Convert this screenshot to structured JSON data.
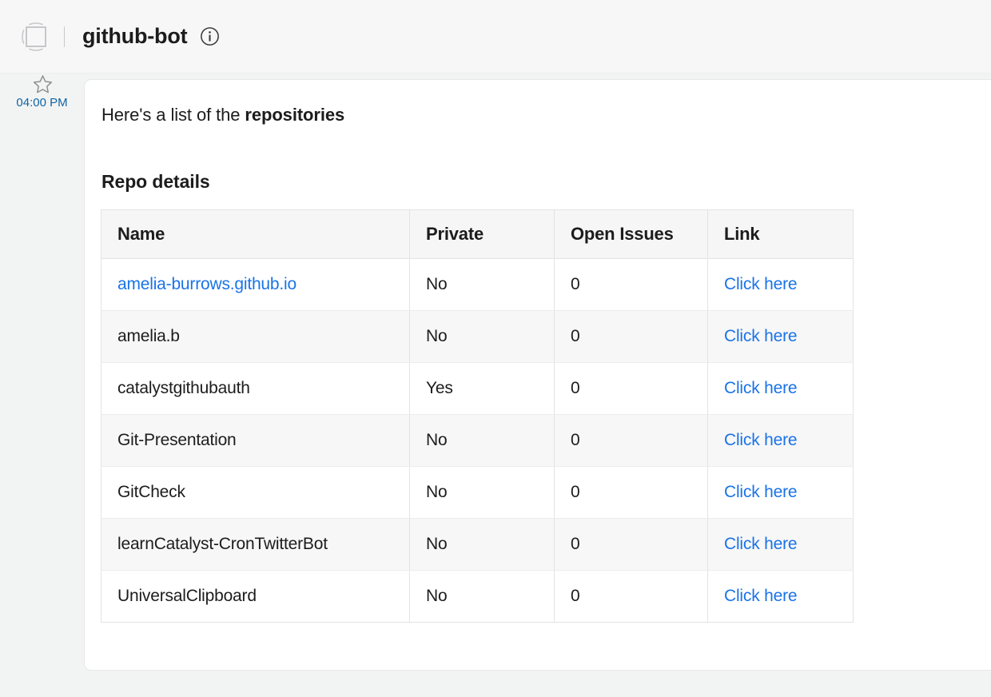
{
  "header": {
    "bot_name": "github-bot",
    "avatar_icon": "app-placeholder-icon",
    "info_icon": "info-circle-icon"
  },
  "gutter": {
    "star_icon": "star-outline-icon",
    "timestamp": "04:00 PM"
  },
  "message": {
    "intro_prefix": "Here's a list of the ",
    "intro_bold": "repositories",
    "section_title": "Repo details"
  },
  "table": {
    "columns": [
      "Name",
      "Private",
      "Open Issues",
      "Link"
    ],
    "rows": [
      {
        "name": "amelia-burrows.github.io",
        "name_is_link": true,
        "private": "No",
        "open_issues": "0",
        "link": "Click here"
      },
      {
        "name": "amelia.b",
        "name_is_link": false,
        "private": "No",
        "open_issues": "0",
        "link": "Click here"
      },
      {
        "name": "catalystgithubauth",
        "name_is_link": false,
        "private": "Yes",
        "open_issues": "0",
        "link": "Click here"
      },
      {
        "name": "Git-Presentation",
        "name_is_link": false,
        "private": "No",
        "open_issues": "0",
        "link": "Click here"
      },
      {
        "name": "GitCheck",
        "name_is_link": false,
        "private": "No",
        "open_issues": "0",
        "link": "Click here"
      },
      {
        "name": "learnCatalyst-CronTwitterBot",
        "name_is_link": false,
        "private": "No",
        "open_issues": "0",
        "link": "Click here"
      },
      {
        "name": "UniversalClipboard",
        "name_is_link": false,
        "private": "No",
        "open_issues": "0",
        "link": "Click here"
      }
    ]
  },
  "colors": {
    "link": "#1a73e8",
    "timestamp": "#1264a3",
    "page_background": "#f2f4f4",
    "header_background": "#f7f7f7",
    "card_background": "#ffffff",
    "table_header_background": "#f6f6f6",
    "table_alt_row_background": "#f7f7f7",
    "text": "#1d1c1d"
  }
}
